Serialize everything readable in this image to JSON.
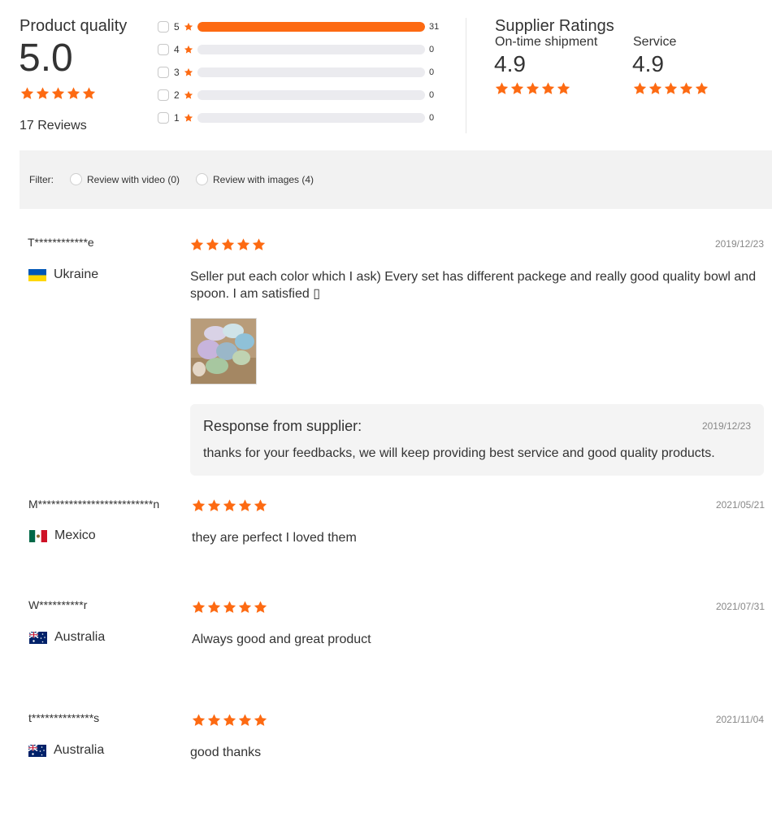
{
  "product_quality": {
    "title": "Product quality",
    "score": "5.0",
    "reviews": "17 Reviews",
    "stars": 5
  },
  "distribution": [
    {
      "label": "5",
      "count": "31",
      "fill": 1.0
    },
    {
      "label": "4",
      "count": "0",
      "fill": 0
    },
    {
      "label": "3",
      "count": "0",
      "fill": 0
    },
    {
      "label": "2",
      "count": "0",
      "fill": 0
    },
    {
      "label": "1",
      "count": "0",
      "fill": 0
    }
  ],
  "supplier": {
    "title": "Supplier Ratings",
    "shipment_label": "On-time shipment",
    "shipment_score": "4.9",
    "service_label": "Service",
    "service_score": "4.9"
  },
  "filter": {
    "label": "Filter:",
    "video": "Review with video (0)",
    "images": "Review with images (4)"
  },
  "colors": {
    "accent": "#fd6a12",
    "bar_track": "#ebebef",
    "panel": "#f2f2f2"
  },
  "reviews": [
    {
      "user": "T************e",
      "country": "Ukraine",
      "flag": "ukraine-flag",
      "date": "2019/12/23",
      "stars": 5,
      "text": "Seller put each color which I ask) Every set has different packege and really good quality bowl and spoon. I am satisfied ▯",
      "response": {
        "title": "Response from supplier:",
        "date": "2019/12/23",
        "text": "thanks for your feedbacks, we will keep providing best service and good quality products."
      }
    },
    {
      "user": "M**************************n",
      "country": "Mexico",
      "flag": "mexico-flag",
      "date": "2021/05/21",
      "stars": 5,
      "text": "they are perfect I loved them"
    },
    {
      "user": "W**********r",
      "country": "Australia",
      "flag": "australia-flag",
      "date": "2021/07/31",
      "stars": 5,
      "text": "Always good and great product"
    },
    {
      "user": "t**************s",
      "country": "Australia",
      "flag": "australia-flag",
      "date": "2021/11/04",
      "stars": 5,
      "text": "good thanks"
    }
  ]
}
